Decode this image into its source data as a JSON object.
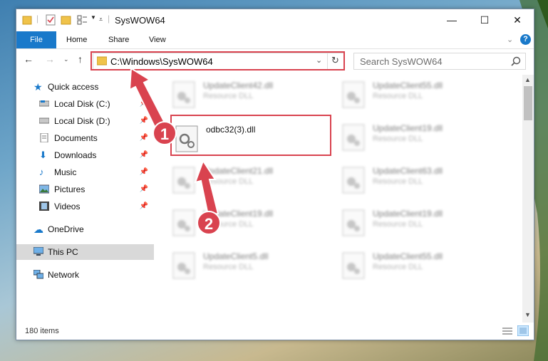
{
  "window": {
    "title": "SysWOW64",
    "controls": {
      "minimize": "—",
      "maximize": "☐",
      "close": "✕"
    }
  },
  "ribbon": {
    "tabs": [
      "File",
      "Home",
      "Share",
      "View"
    ],
    "expand": "⌄",
    "help": "?"
  },
  "address": {
    "path": "C:\\Windows\\SysWOW64",
    "search_placeholder": "Search SysWOW64"
  },
  "nav": {
    "quick_access": "Quick access",
    "items": [
      {
        "label": "Local Disk (C:)"
      },
      {
        "label": "Local Disk (D:)"
      },
      {
        "label": "Documents"
      },
      {
        "label": "Downloads"
      },
      {
        "label": "Music"
      },
      {
        "label": "Pictures"
      },
      {
        "label": "Videos"
      }
    ],
    "onedrive": "OneDrive",
    "this_pc": "This PC",
    "network": "Network"
  },
  "files": {
    "highlighted": {
      "name": "odbc32(3).dll"
    },
    "left_column": [
      {
        "name": "UpdateClient42.dll",
        "type": "Resource DLL"
      },
      {
        "name": "UpdateClient21.dll",
        "type": "Resource DLL"
      },
      {
        "name": "UpdateClient19.dll",
        "type": "Resource DLL"
      },
      {
        "name": "UpdateClient5.dll",
        "type": "Resource DLL"
      }
    ],
    "right_column": [
      {
        "name": "UpdateClient55.dll",
        "type": "Resource DLL"
      },
      {
        "name": "UpdateClient19.dll",
        "type": "Resource DLL"
      },
      {
        "name": "UpdateClient63.dll",
        "type": "Resource DLL"
      },
      {
        "name": "UpdateClient19.dll",
        "type": "Resource DLL"
      },
      {
        "name": "UpdateClient55.dll",
        "type": "Resource DLL"
      }
    ]
  },
  "status": {
    "item_count": "180 items"
  },
  "annotations": {
    "step1": "1",
    "step2": "2",
    "color": "#d9434f"
  }
}
